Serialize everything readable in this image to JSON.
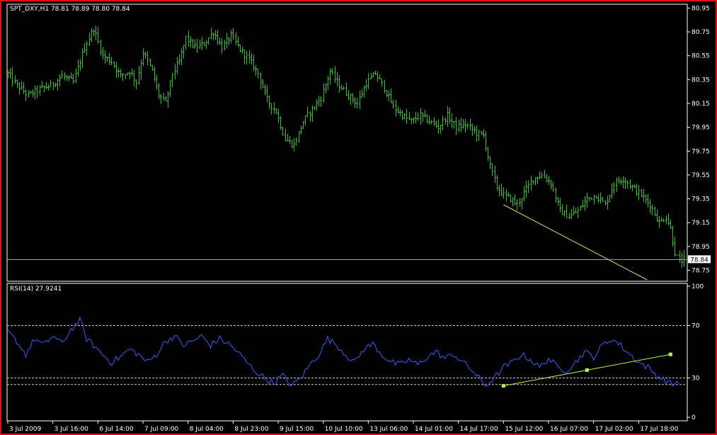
{
  "colors": {
    "background": "#000000",
    "axis": "#ffffff",
    "bars": "#2fbf2f",
    "rsi_line": "#3a5cff",
    "trendline": "#b6f24a",
    "frame": "#e01010"
  },
  "chart_data": [
    {
      "type": "line",
      "symbol_header": "SPT_DXY,H1  78.81 78.89 78.80 78.84",
      "current_price_label": "78.84",
      "current_price": 78.84,
      "ylim": [
        78.67,
        80.97
      ],
      "yticks": [
        "80.95",
        "80.75",
        "80.55",
        "80.35",
        "80.15",
        "79.95",
        "79.75",
        "79.55",
        "79.35",
        "79.15",
        "78.95",
        "78.75"
      ],
      "xticks": [
        "3 Jul 2009",
        "3 Jul 16:00",
        "6 Jul 14:00",
        "7 Jul 09:00",
        "8 Jul 04:00",
        "8 Jul 23:00",
        "9 Jul 15:00",
        "10 Jul 10:00",
        "13 Jul 06:00",
        "14 Jul 01:00",
        "14 Jul 17:00",
        "15 Jul 12:00",
        "16 Jul 07:00",
        "17 Jul 02:00",
        "17 Jul 18:00"
      ],
      "close_anchors": [
        [
          0,
          80.4
        ],
        [
          4,
          80.3
        ],
        [
          9,
          80.22
        ],
        [
          14,
          80.27
        ],
        [
          19,
          80.3
        ],
        [
          24,
          80.38
        ],
        [
          29,
          80.33
        ],
        [
          34,
          80.62
        ],
        [
          38,
          80.78
        ],
        [
          42,
          80.55
        ],
        [
          46,
          80.5
        ],
        [
          50,
          80.38
        ],
        [
          54,
          80.42
        ],
        [
          57,
          80.33
        ],
        [
          60,
          80.58
        ],
        [
          64,
          80.42
        ],
        [
          67,
          80.22
        ],
        [
          70,
          80.15
        ],
        [
          73,
          80.4
        ],
        [
          76,
          80.5
        ],
        [
          79,
          80.7
        ],
        [
          83,
          80.62
        ],
        [
          87,
          80.65
        ],
        [
          91,
          80.75
        ],
        [
          95,
          80.62
        ],
        [
          99,
          80.72
        ],
        [
          103,
          80.6
        ],
        [
          107,
          80.52
        ],
        [
          111,
          80.4
        ],
        [
          115,
          80.18
        ],
        [
          119,
          80.08
        ],
        [
          123,
          79.85
        ],
        [
          127,
          79.8
        ],
        [
          131,
          80.0
        ],
        [
          135,
          80.1
        ],
        [
          139,
          80.2
        ],
        [
          143,
          80.42
        ],
        [
          147,
          80.3
        ],
        [
          151,
          80.22
        ],
        [
          155,
          80.15
        ],
        [
          159,
          80.32
        ],
        [
          163,
          80.4
        ],
        [
          167,
          80.28
        ],
        [
          171,
          80.12
        ],
        [
          175,
          80.05
        ],
        [
          179,
          80.0
        ],
        [
          183,
          80.05
        ],
        [
          187,
          80.0
        ],
        [
          191,
          79.95
        ],
        [
          195,
          80.05
        ],
        [
          199,
          79.95
        ],
        [
          203,
          79.97
        ],
        [
          205,
          79.95
        ],
        [
          208,
          79.9
        ],
        [
          211,
          79.88
        ],
        [
          214,
          79.62
        ],
        [
          217,
          79.45
        ],
        [
          220,
          79.38
        ],
        [
          223,
          79.35
        ],
        [
          226,
          79.3
        ],
        [
          229,
          79.4
        ],
        [
          233,
          79.52
        ],
        [
          237,
          79.55
        ],
        [
          241,
          79.48
        ],
        [
          245,
          79.25
        ],
        [
          249,
          79.2
        ],
        [
          253,
          79.25
        ],
        [
          257,
          79.35
        ],
        [
          261,
          79.38
        ],
        [
          265,
          79.3
        ],
        [
          269,
          79.48
        ],
        [
          273,
          79.52
        ],
        [
          277,
          79.45
        ],
        [
          281,
          79.38
        ],
        [
          285,
          79.3
        ],
        [
          289,
          79.15
        ],
        [
          292,
          79.2
        ],
        [
          294,
          79.1
        ],
        [
          296,
          78.9
        ],
        [
          298,
          78.82
        ],
        [
          300,
          78.84
        ]
      ],
      "trendline": {
        "from": [
          "15 Jul 12:00",
          79.3
        ],
        "to": [
          "17 Jul 18:00",
          78.67
        ]
      }
    },
    {
      "type": "line",
      "title": "RSI(14) 27.9241",
      "ylim": [
        0,
        100
      ],
      "yticks": [
        "100",
        "70",
        "30",
        "0"
      ],
      "levels": [
        70,
        30,
        25
      ],
      "anchors": [
        [
          0,
          65
        ],
        [
          4,
          58
        ],
        [
          8,
          48
        ],
        [
          12,
          60
        ],
        [
          16,
          55
        ],
        [
          20,
          62
        ],
        [
          24,
          56
        ],
        [
          28,
          67
        ],
        [
          32,
          74
        ],
        [
          35,
          60
        ],
        [
          38,
          55
        ],
        [
          42,
          48
        ],
        [
          46,
          42
        ],
        [
          50,
          46
        ],
        [
          54,
          52
        ],
        [
          58,
          48
        ],
        [
          62,
          42
        ],
        [
          66,
          48
        ],
        [
          70,
          58
        ],
        [
          74,
          62
        ],
        [
          78,
          55
        ],
        [
          82,
          58
        ],
        [
          86,
          62
        ],
        [
          90,
          55
        ],
        [
          94,
          60
        ],
        [
          98,
          56
        ],
        [
          102,
          50
        ],
        [
          106,
          42
        ],
        [
          110,
          35
        ],
        [
          114,
          30
        ],
        [
          118,
          26
        ],
        [
          122,
          32
        ],
        [
          126,
          24
        ],
        [
          130,
          30
        ],
        [
          134,
          40
        ],
        [
          138,
          48
        ],
        [
          142,
          60
        ],
        [
          146,
          55
        ],
        [
          150,
          48
        ],
        [
          154,
          42
        ],
        [
          158,
          52
        ],
        [
          162,
          56
        ],
        [
          166,
          48
        ],
        [
          170,
          42
        ],
        [
          174,
          40
        ],
        [
          178,
          44
        ],
        [
          182,
          40
        ],
        [
          186,
          46
        ],
        [
          190,
          50
        ],
        [
          194,
          45
        ],
        [
          198,
          48
        ],
        [
          202,
          42
        ],
        [
          206,
          36
        ],
        [
          209,
          30
        ],
        [
          212,
          24
        ],
        [
          216,
          30
        ],
        [
          220,
          38
        ],
        [
          224,
          42
        ],
        [
          228,
          48
        ],
        [
          232,
          44
        ],
        [
          236,
          38
        ],
        [
          240,
          45
        ],
        [
          244,
          38
        ],
        [
          248,
          36
        ],
        [
          252,
          42
        ],
        [
          256,
          50
        ],
        [
          260,
          46
        ],
        [
          264,
          55
        ],
        [
          268,
          60
        ],
        [
          272,
          55
        ],
        [
          276,
          48
        ],
        [
          280,
          42
        ],
        [
          284,
          38
        ],
        [
          288,
          32
        ],
        [
          292,
          28
        ],
        [
          295,
          25
        ],
        [
          298,
          27.9
        ]
      ],
      "trendline": {
        "from": [
          "15 Jul 12:00",
          24
        ],
        "to": [
          "17 Jul 18:00",
          48
        ]
      }
    }
  ]
}
